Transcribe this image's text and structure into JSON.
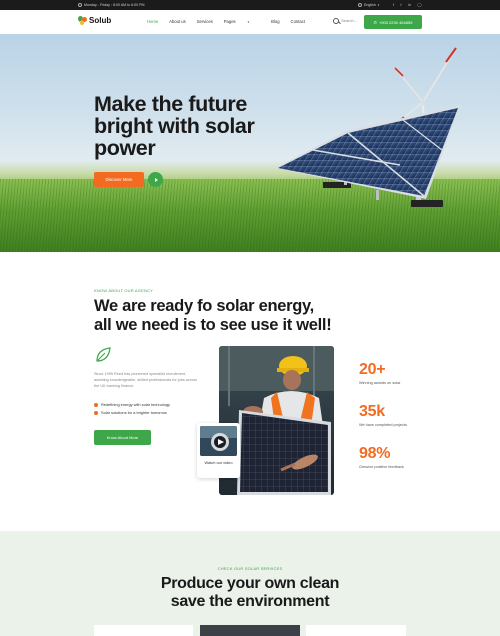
{
  "topbar": {
    "hours": "Monday - Friday : 8:00 AM to 6:00 PM",
    "language": "English",
    "socials": [
      "facebook-icon",
      "twitter-icon",
      "linkedin-icon",
      "instagram-icon"
    ]
  },
  "header": {
    "logo": "Solub",
    "menu": [
      {
        "label": "Home",
        "active": true
      },
      {
        "label": "About us"
      },
      {
        "label": "Services"
      },
      {
        "label": "Pages"
      },
      {
        "label": "Blog"
      },
      {
        "label": "Contact"
      }
    ],
    "search_placeholder": "Search...",
    "phone": "+000 2230 404655"
  },
  "hero": {
    "title": "Make the future bright with solar power",
    "cta": "Discover More"
  },
  "about": {
    "kicker": "KNOW ABOUT OUR AGENCY",
    "title": "We are ready fo solar energy, all we need is to see use it well!",
    "text": "Since 1995 Reed has pioneered specialist recruitment, assisting knowledgeable, skilled professionals for jobs across the UK banking finance.",
    "bullets": [
      "Redefining energy with solar technology",
      "Solar solutions for a brighter tomorrow"
    ],
    "button": "Know About More",
    "video_label": "Watch our video"
  },
  "stats": [
    {
      "number": "20+",
      "label": "Winning awards on solar"
    },
    {
      "number": "35k",
      "label": "We have completed projects"
    },
    {
      "number": "98%",
      "label": "Genuine positive feedback"
    }
  ],
  "services": {
    "kicker": "CHECK OUR SOLAR SERVICES",
    "title": "Produce your own clean save the environment"
  },
  "colors": {
    "brand_green": "#3da74a",
    "accent_orange": "#f26b21",
    "dark_bar": "#1b1b1b",
    "services_bg": "#eaf2ea"
  }
}
